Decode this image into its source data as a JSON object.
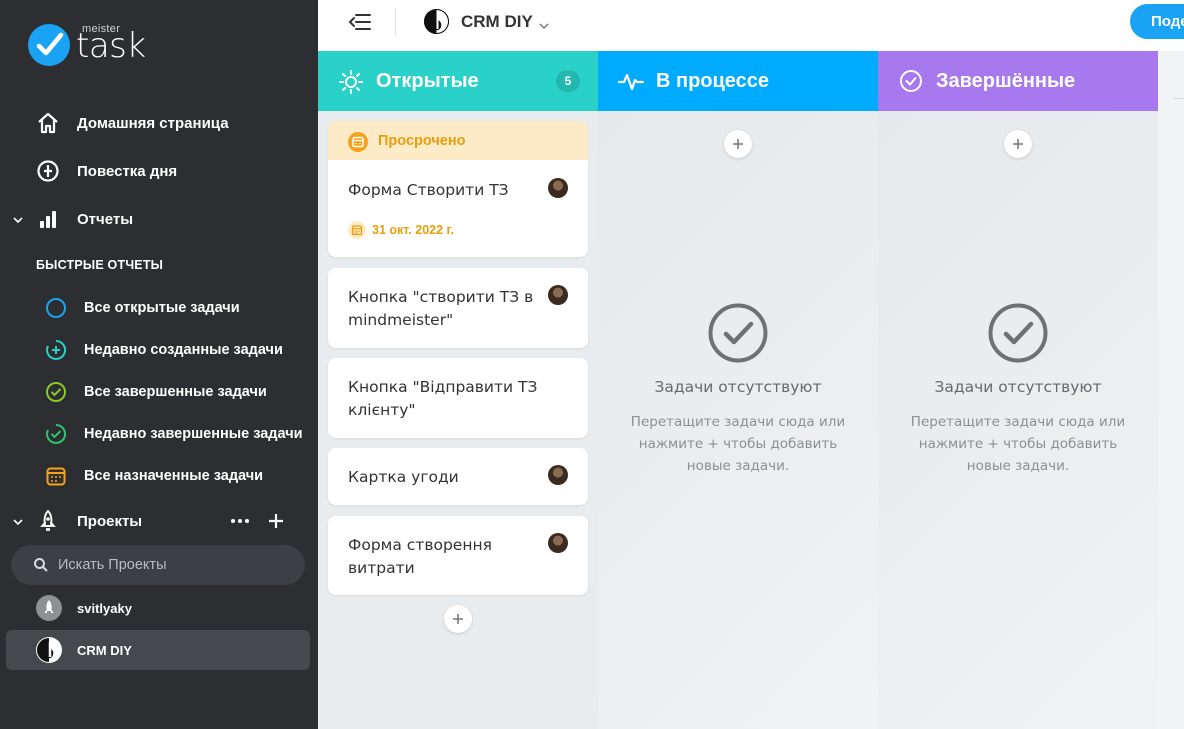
{
  "app": {
    "logo_small": "meister",
    "logo_big": "task"
  },
  "sidebar": {
    "nav": [
      {
        "label": "Домашняя страница",
        "icon": "home-icon"
      },
      {
        "label": "Повестка дня",
        "icon": "agenda-icon"
      },
      {
        "label": "Отчеты",
        "icon": "bar-chart-icon"
      }
    ],
    "quick_reports_title": "БЫСТРЫЕ ОТЧЕТЫ",
    "quick_reports": [
      {
        "label": "Все открытые задачи",
        "icon": "circle-icon",
        "color": "#1aa3f4"
      },
      {
        "label": "Недавно созданные задачи",
        "icon": "circle-plus-icon",
        "color": "#2ad1c9"
      },
      {
        "label": "Все завершенные задачи",
        "icon": "circle-check-icon",
        "color": "#8ac925"
      },
      {
        "label": "Недавно завершенные задачи",
        "icon": "circle-check-clock-icon",
        "color": "#2fc56b"
      },
      {
        "label": "Все назначенные задачи",
        "icon": "calendar-icon",
        "color": "#f7a21b"
      }
    ],
    "projects_label": "Проекты",
    "search_placeholder": "Искать Проекты",
    "projects": [
      {
        "label": "svitlyaky",
        "active": false
      },
      {
        "label": "CRM DIY",
        "active": true
      }
    ]
  },
  "topbar": {
    "project_title": "CRM DIY",
    "share_label": "Поде"
  },
  "columns": [
    {
      "title": "Открытые",
      "count": "5",
      "color": "#2ad1c9",
      "icon": "sun-icon",
      "overdue_label": "Просрочено",
      "tasks": [
        {
          "title": "Форма Створити ТЗ",
          "due": "31 окт. 2022 г."
        },
        {
          "title": "Кнопка \"створити ТЗ в mindmeister\""
        },
        {
          "title": "Кнопка \"Відправити ТЗ клієнту\""
        },
        {
          "title": "Картка угоди"
        },
        {
          "title": "Форма створення витрати"
        }
      ]
    },
    {
      "title": "В процессе",
      "color": "#00aaff",
      "icon": "activity-icon",
      "empty_title": "Задачи отсутствуют",
      "empty_text": "Перетащите задачи сюда или нажмите + чтобы добавить новые задачи."
    },
    {
      "title": "Завершённые",
      "color": "#a878ef",
      "icon": "check-circle-icon",
      "empty_title": "Задачи отсутствуют",
      "empty_text": "Перетащите задачи сюда или нажмите + чтобы добавить новые задачи."
    }
  ]
}
